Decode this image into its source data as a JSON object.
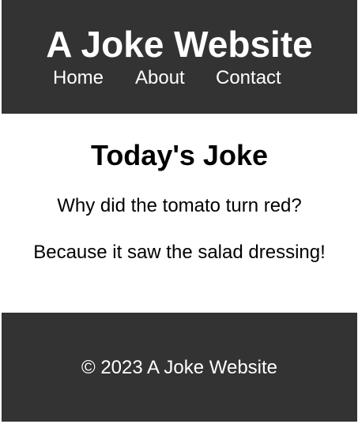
{
  "header": {
    "title": "A Joke Website",
    "nav": [
      {
        "label": "Home"
      },
      {
        "label": "About"
      },
      {
        "label": "Contact"
      }
    ]
  },
  "main": {
    "heading": "Today's Joke",
    "setup": "Why did the tomato turn red?",
    "punchline": "Because it saw the salad dressing!"
  },
  "footer": {
    "text": "© 2023 A Joke Website"
  },
  "colors": {
    "header_bg": "#333333",
    "footer_bg": "#333333",
    "header_text": "#ffffff",
    "body_text": "#000000"
  }
}
